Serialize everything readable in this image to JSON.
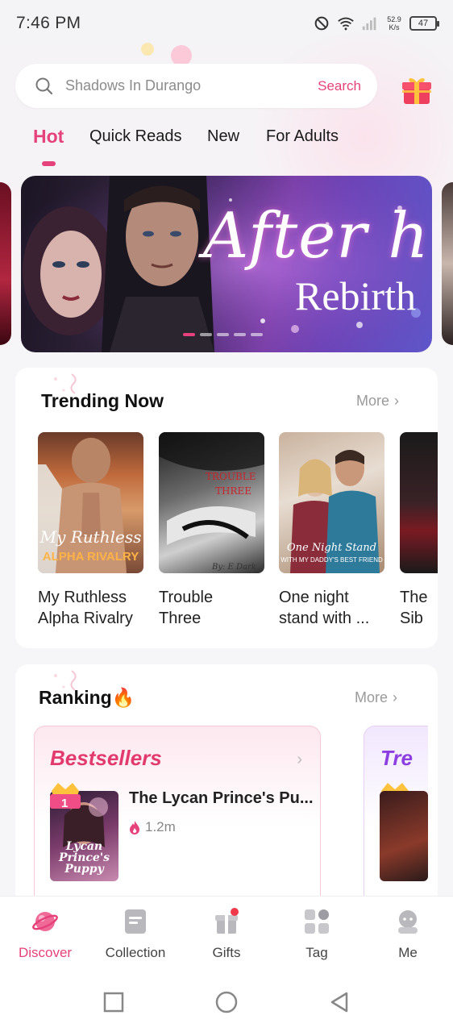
{
  "status_bar": {
    "time": "7:46 PM",
    "net_speed_value": "52.9",
    "net_speed_unit": "K/s",
    "battery": "47"
  },
  "search": {
    "placeholder": "Shadows In Durango",
    "button_label": "Search"
  },
  "tabs": [
    {
      "label": "Hot",
      "active": true
    },
    {
      "label": "Quick Reads",
      "active": false
    },
    {
      "label": "New",
      "active": false
    },
    {
      "label": "For Adults",
      "active": false
    }
  ],
  "banner": {
    "title": "After h",
    "subtitle": "Rebirth",
    "page_count": 5,
    "current_page": 1
  },
  "trending": {
    "title": "Trending Now",
    "more_label": "More",
    "books": [
      {
        "title_line1": "My Ruthless",
        "title_line2": "Alpha Rivalry",
        "cover_text": "My Ruthless",
        "cover_text2": "ALPHA RIVALRY"
      },
      {
        "title_line1": "Trouble",
        "title_line2": "Three",
        "cover_text": "TROUBLE",
        "cover_text2": "THREE",
        "cover_author": "By: E Dark"
      },
      {
        "title_line1": "One night",
        "title_line2": "stand with ...",
        "cover_text": "One Night Stand",
        "cover_text2": "WITH MY DADDY'S BEST FRIEND"
      },
      {
        "title_line1": "The",
        "title_line2": "Sib"
      }
    ]
  },
  "ranking": {
    "title": "Ranking",
    "more_label": "More",
    "boards": [
      {
        "label": "Bestsellers",
        "rank": "1",
        "book_title": "The Lycan Prince's Pu...",
        "reads": "1.2m",
        "cover_text": "Lycan Prince's Puppy"
      },
      {
        "label": "Tre",
        "rank": "1"
      }
    ]
  },
  "bottom_nav": [
    {
      "label": "Discover",
      "icon": "planet-icon",
      "active": true
    },
    {
      "label": "Collection",
      "icon": "book-icon",
      "active": false
    },
    {
      "label": "Gifts",
      "icon": "gift-icon",
      "active": false
    },
    {
      "label": "Tag",
      "icon": "tag-grid-icon",
      "active": false
    },
    {
      "label": "Me",
      "icon": "profile-icon",
      "active": false
    }
  ],
  "colors": {
    "accent": "#e5417a",
    "purple": "#8c3fe0"
  }
}
